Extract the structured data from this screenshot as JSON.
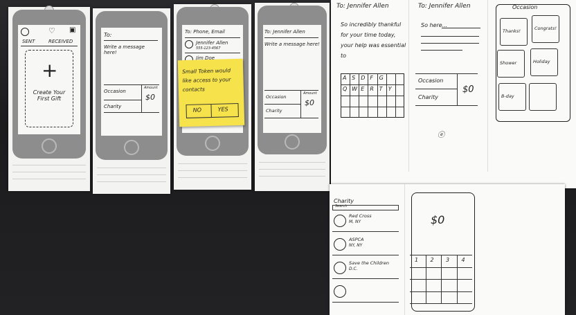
{
  "sketch1": {
    "tab_left": "SENT",
    "tab_right": "RECEIVED",
    "create_text": "Create Your First Gift"
  },
  "sketch2": {
    "to": "To:",
    "message": "Write a message here!",
    "occasion": "Occasion",
    "charity": "Charity",
    "amount": "Amount",
    "dollar": "$0"
  },
  "sketch3": {
    "to": "To: Phone, Email",
    "contact1": "Jennifer Allen",
    "contact1_phone": "555-123-4567",
    "contact2": "Jim Doe",
    "sticky_text": "Small Token would like access to your contacts",
    "sticky_no": "NO",
    "sticky_yes": "YES"
  },
  "sketch4": {
    "to": "To: Jennifer Allen",
    "message": "Write a message here!",
    "occasion": "Occasion",
    "charity": "Charity",
    "amount": "Amount",
    "dollar": "$0"
  },
  "paper_big": {
    "to1": "To: Jennifer Allen",
    "msg1": "So incredibly thankful for your time today, your help was essential to",
    "keys": [
      "A",
      "S",
      "D",
      "F",
      "G",
      "Q",
      "W",
      "E",
      "R",
      "T",
      "Y"
    ],
    "to2": "To: Jennifer Allen",
    "so_far": "So here...",
    "occasion": "Occasion",
    "charity": "Charity",
    "dollar": "$0",
    "occasions_title": "Occasion",
    "occasions": [
      "Thanks!",
      "Congrats!",
      "Shower",
      "Holiday",
      "B-day"
    ]
  },
  "paper_bottom": {
    "title": "Charity",
    "search": "Search",
    "charities": [
      {
        "name": "Red Cross",
        "place": "M, NY"
      },
      {
        "name": "ASPCA",
        "place": "NY, NY"
      },
      {
        "name": "Save the Children",
        "place": "D.C."
      },
      {
        "name": "",
        "place": ""
      }
    ],
    "dollar": "$0",
    "keypad": [
      "1",
      "2",
      "3",
      "4"
    ]
  }
}
